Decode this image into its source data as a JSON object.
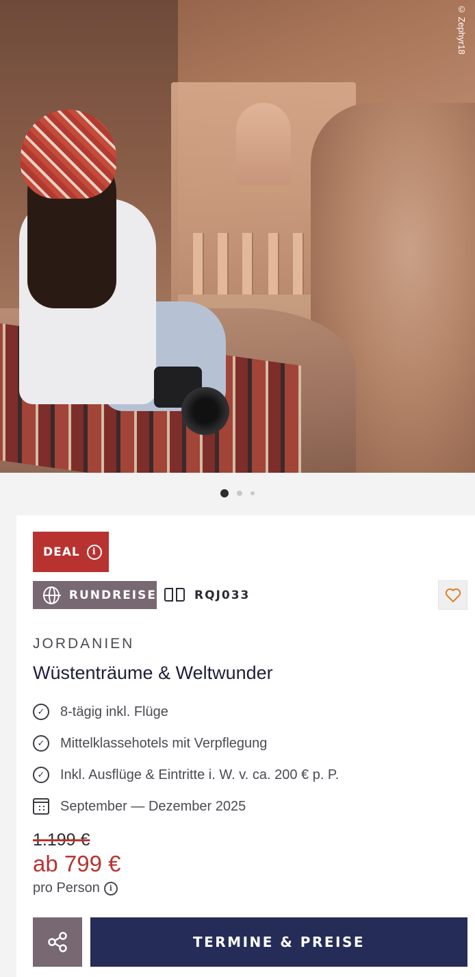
{
  "hero": {
    "photo_credit": "© Zephyr18",
    "slides": 3,
    "active_slide": 1
  },
  "badges": {
    "deal": "DEAL",
    "tour_type": "RUNDREISE",
    "tour_code": "RQJ033"
  },
  "trip": {
    "country": "JORDANIEN",
    "title": "Wüstenträume & Weltwunder",
    "features": [
      "8-tägig inkl. Flüge",
      "Mittelklassehotels mit Verpflegung",
      "Inkl. Ausflüge & Eintritte i. W. v. ca. 200 € p. P."
    ],
    "dates": "September — Dezember 2025"
  },
  "pricing": {
    "old_price": "1.199 €",
    "price": "ab 799 €",
    "per_person": "pro Person"
  },
  "actions": {
    "cta_label": "TERMINE & PREISE"
  },
  "colors": {
    "deal_red": "#b83330",
    "tour_mauve": "#786871",
    "cta_navy": "#252c58",
    "heart_orange": "#d9822b"
  }
}
